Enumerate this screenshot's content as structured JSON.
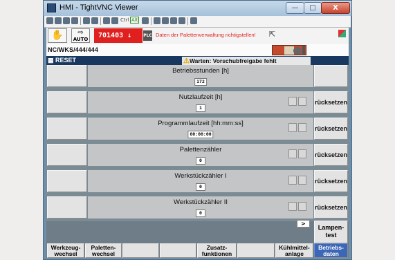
{
  "window": {
    "title": "HMI - TightVNC Viewer",
    "close_label": "X"
  },
  "vnc_toolbar": {
    "ctrl_label": "Ctrl",
    "alt_label": "Alt"
  },
  "header": {
    "mode_label": "AUTO",
    "alarm_number": "701403",
    "alarm_arrow": "↓",
    "plc_label": "PLC",
    "alarm_text": "Daten der Palettenverwaltung richtigstellen!",
    "alarm_color": "#e01f1f"
  },
  "path": "NC/WKS/444/444",
  "status": {
    "reset": "RESET",
    "warning": "Warten: Vorschubfreigabe fehlt"
  },
  "rows": [
    {
      "label": "Betriebsstunden [h]",
      "value": "172",
      "right_button": ""
    },
    {
      "label": "Nutzlaufzeit [h]",
      "value": "1",
      "right_button": "rücksetzen"
    },
    {
      "label": "Programmlaufzeit [hh:mm:ss]",
      "value": "00:00:00",
      "right_button": "rücksetzen"
    },
    {
      "label": "Palettenzähler",
      "value": "0",
      "right_button": "rücksetzen"
    },
    {
      "label": "Werkstückzähler I",
      "value": "0",
      "right_button": "rücksetzen"
    },
    {
      "label": "Werkstückzähler II",
      "value": "0",
      "right_button": "rücksetzen"
    }
  ],
  "scroll_arrow": ">",
  "lampentest": "Lampen-\ntest",
  "horizontal_softkeys": [
    "Werkzeug-\nwechsel",
    "Paletten-\nwechsel",
    "",
    "",
    "Zusatz-\nfunktionen",
    "",
    "Kühlmittel-\nanlage",
    "Betriebs-\ndaten"
  ],
  "colors": {
    "active_softkey": "#3c66b6",
    "status_bar": "#183860",
    "window_frame": "#6f8fa9"
  }
}
